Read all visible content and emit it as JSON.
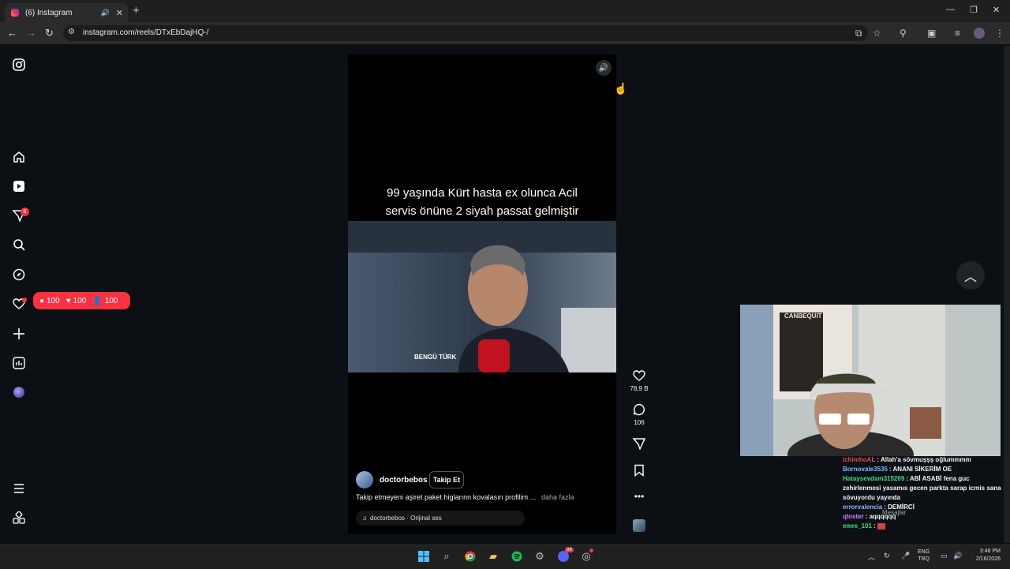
{
  "browser": {
    "tab_title": "(6) Instagram",
    "url": "instagram.com/reels/DTxEbDajHQ-/"
  },
  "sidebar": {
    "activity_badge": "6",
    "notifications": {
      "comments": "100",
      "likes": "100",
      "follows": "100"
    }
  },
  "reel": {
    "caption_line1": "99 yaşında Kürt hasta ex olunca Acil",
    "caption_line2": "servis önüne 2 siyah passat gelmiştir",
    "overlay_badge": "BENGÜ TÜRK",
    "username": "doctorbebos",
    "follow_label": "Takip Et",
    "description": "Takip etmeyeni aşiret paket higlarınn kovalasın profilim ...",
    "more_label": "daha fazla",
    "audio": "doctorbebos · Orijinal ses",
    "likes": "78,9 B",
    "comments": "106"
  },
  "webcam": {
    "poster_text": "CANBEQUIT"
  },
  "chat": [
    {
      "user": "ichimhoAL",
      "color": "#e84d4d",
      "msg": "Allah'a sövmuşşş oğlummmm"
    },
    {
      "user": "Bornovale3535",
      "color": "#7fb8ff",
      "msg": "ANANI SİKERİM OE"
    },
    {
      "user": "Hataysevdam315269",
      "color": "#3ddc84",
      "msg": "ABİ ASABİ fena guc zehirlenmesi yasamıs gecen parkta sarap icmis sana sövuyordu yayında"
    },
    {
      "user": "errorvalencia",
      "color": "#7fb8ff",
      "msg": "DEMİRCİ"
    },
    {
      "user": "qloster",
      "color": "#c48aff",
      "msg": "aqqqqqq"
    },
    {
      "user": "emre_101",
      "color": "#3ddc84",
      "msg": ""
    }
  ],
  "chat_input_placeholder": "Mesajlar",
  "taskbar": {
    "lang_top": "ENG",
    "lang_bottom": "TRQ",
    "time": "3:48 PM",
    "date": "2/16/2026",
    "discord_badge": "99"
  },
  "colors": {
    "accent_red": "#ff3040",
    "bg": "#0c1014"
  }
}
